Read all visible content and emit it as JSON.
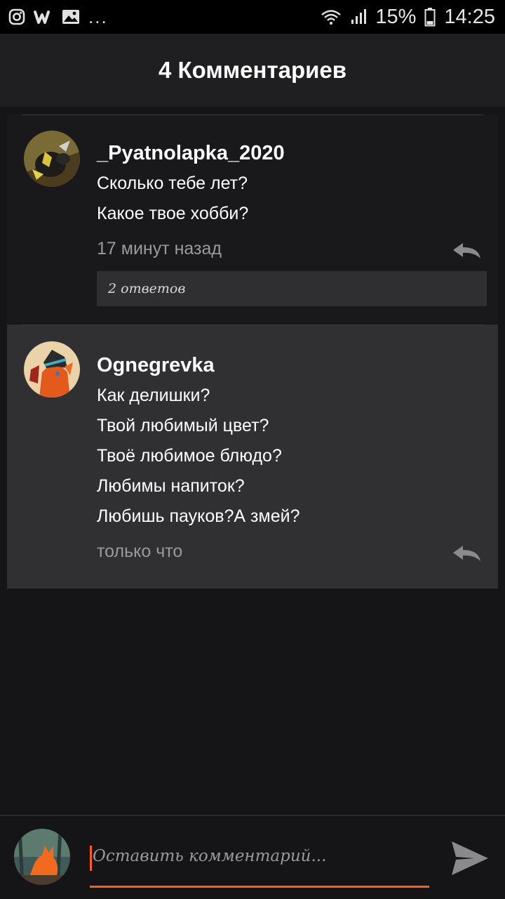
{
  "status_bar": {
    "icons_left": [
      "instagram-icon",
      "wattpad-icon",
      "gallery-icon"
    ],
    "more": "...",
    "battery": "15%",
    "time": "14:25"
  },
  "header": {
    "title": "4 Комментариев"
  },
  "comments": [
    {
      "username": "_Pyatnolapka_2020",
      "lines": [
        "Сколько тебе лет?",
        "Какое твое хобби?"
      ],
      "time": "17 минут назад",
      "replies": "2 ответов"
    },
    {
      "username": "Ognegrevka",
      "lines": [
        "Как делишки?",
        "Твой любимый цвет?",
        "Твоё любимое блюдо?",
        "Любимы напиток?",
        "Любишь пауков?А змей?"
      ],
      "time": "только что"
    }
  ],
  "input": {
    "placeholder": "Оставить комментарий..."
  },
  "colors": {
    "accent": "#ff5a1f",
    "background": "#151416",
    "header": "#1f1e20",
    "highlight": "#302f31"
  }
}
